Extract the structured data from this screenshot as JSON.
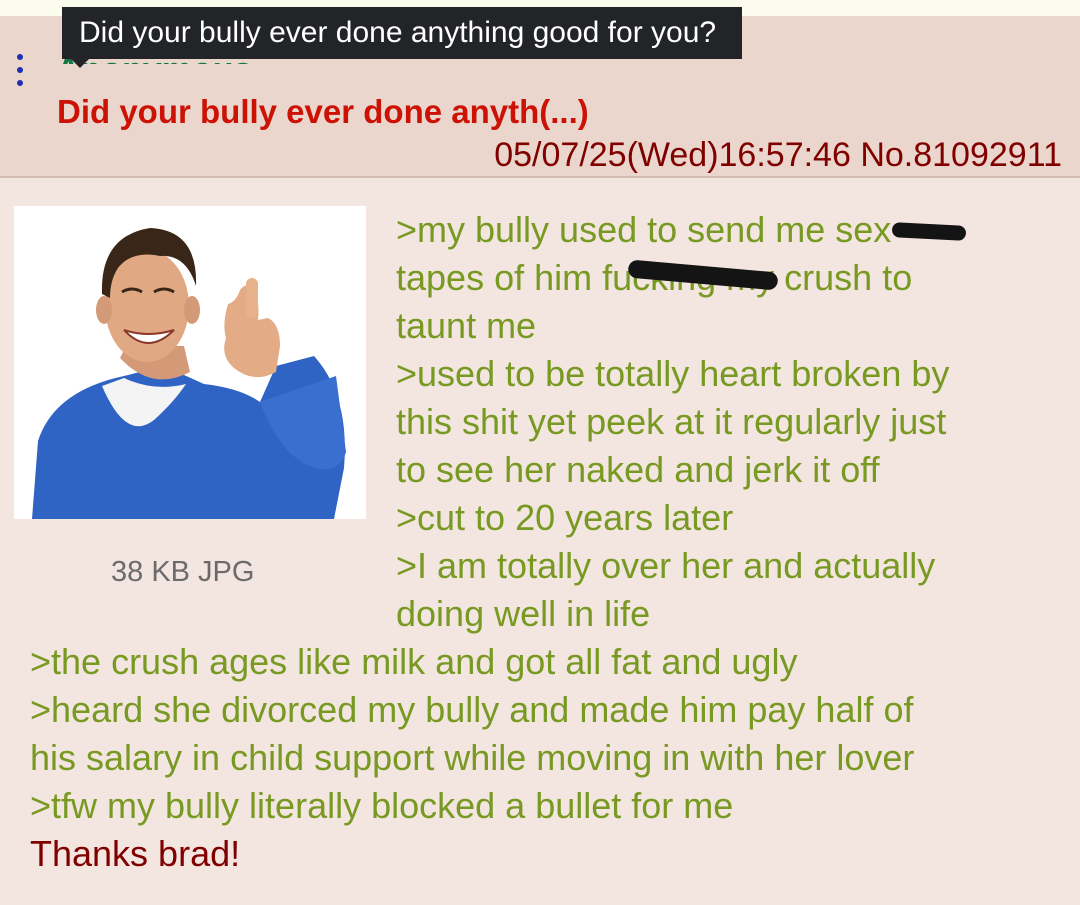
{
  "header": {
    "poster_name": "Anonymous",
    "subject": "Did your bully ever done anyth(...)",
    "tooltip": "Did your bully ever done anything good for you?",
    "datetime": "05/07/25(Wed)16:57:46",
    "post_number": "No.81092911"
  },
  "file": {
    "info": "38 KB JPG",
    "thumbnail_description": "smiling man in blue sweater giving thumbs up"
  },
  "comment": {
    "lines": [
      ">my bully used to send me sex",
      "tapes of him fucking my crush to",
      "taunt me",
      ">used to be totally heart broken by",
      "this shit yet peek at it regularly just",
      "to see her naked and jerk it off",
      ">cut to 20 years later",
      ">I am totally over her and actually",
      "doing well in life",
      ">the crush ages like milk and got all fat and ugly",
      ">heard she divorced my bully and made him pay half of",
      "his salary in child support while moving in with her lover",
      ">tfw my bully literally blocked a bullet for me"
    ],
    "closing": "Thanks brad!"
  },
  "colors": {
    "greentext": "#789922",
    "plaintext": "#800000",
    "subject": "#cc1105",
    "name": "#117743",
    "post_bg": "#f3e5df",
    "header_bg": "#ead6cc",
    "menu_dots": "#1c2fb5"
  },
  "icons": {
    "menu": "vertical-ellipsis-icon"
  }
}
